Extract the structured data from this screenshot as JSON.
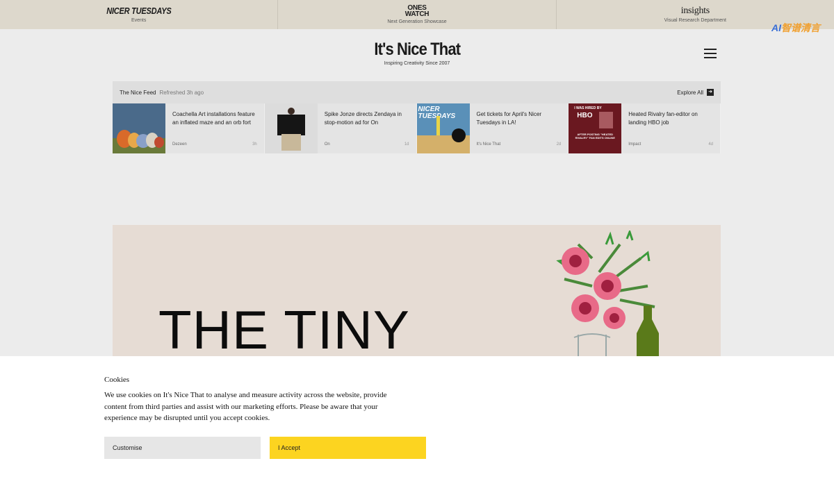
{
  "topbar": [
    {
      "brand": "NICER TUESDAYS",
      "sub": "Events"
    },
    {
      "brand_line1": "ONES",
      "brand_line2": "WATCH",
      "sub": "Next Generation Showcase"
    },
    {
      "brand": "insights",
      "sub": "Visual Research Department"
    }
  ],
  "watermark": {
    "text_a": "AI",
    "text_b": "智谱清言"
  },
  "header": {
    "logo": "It's Nice That",
    "tagline": "Inspiring Creativity Since 2007"
  },
  "feed": {
    "title": "The Nice Feed",
    "refreshed": "Refreshed 3h ago",
    "explore": "Explore All",
    "items": [
      {
        "headline": "Coachella Art installations feature an inflated maze and an orb fort",
        "source": "Dezeen",
        "age": "3h",
        "thumb_icon": "inflatable-orbs-image"
      },
      {
        "headline": "Spike Jonze directs Zendaya in stop-motion ad for On",
        "source": "On",
        "age": "1d",
        "thumb_icon": "person-black-coat-image"
      },
      {
        "headline": "Get tickets for April's Nicer Tuesdays in LA!",
        "source": "It's Nice That",
        "age": "2d",
        "thumb_icon": "nicer-tuesdays-poster-image",
        "thumb_text": "NICER TUESDAYS"
      },
      {
        "headline": "Heated Rivalry fan-editor on landing HBO job",
        "source": "Impact",
        "age": "4d",
        "thumb_icon": "hbo-poster-image",
        "thumb_text_a": "I WAS HIRED BY",
        "thumb_text_b": "HBO",
        "thumb_text_c": "AFTER POSTING \"HEATED RIVALRY\" FAN EDITS ONLINE"
      }
    ]
  },
  "hero": {
    "headline": "THE TINY",
    "image_icon": "flowers-in-vase-illustration"
  },
  "cookies": {
    "title": "Cookies",
    "body": "We use cookies on It's Nice That to analyse and measure activity across the website, provide content from third parties and assist with our marketing efforts. Please be aware that your experience may be disrupted until you accept cookies.",
    "customise_label": "Customise",
    "accept_label": "I Accept"
  },
  "colors": {
    "topbar": "#ddd8cc",
    "accept": "#fcd420",
    "hero_bg": "#e6dcd4"
  }
}
